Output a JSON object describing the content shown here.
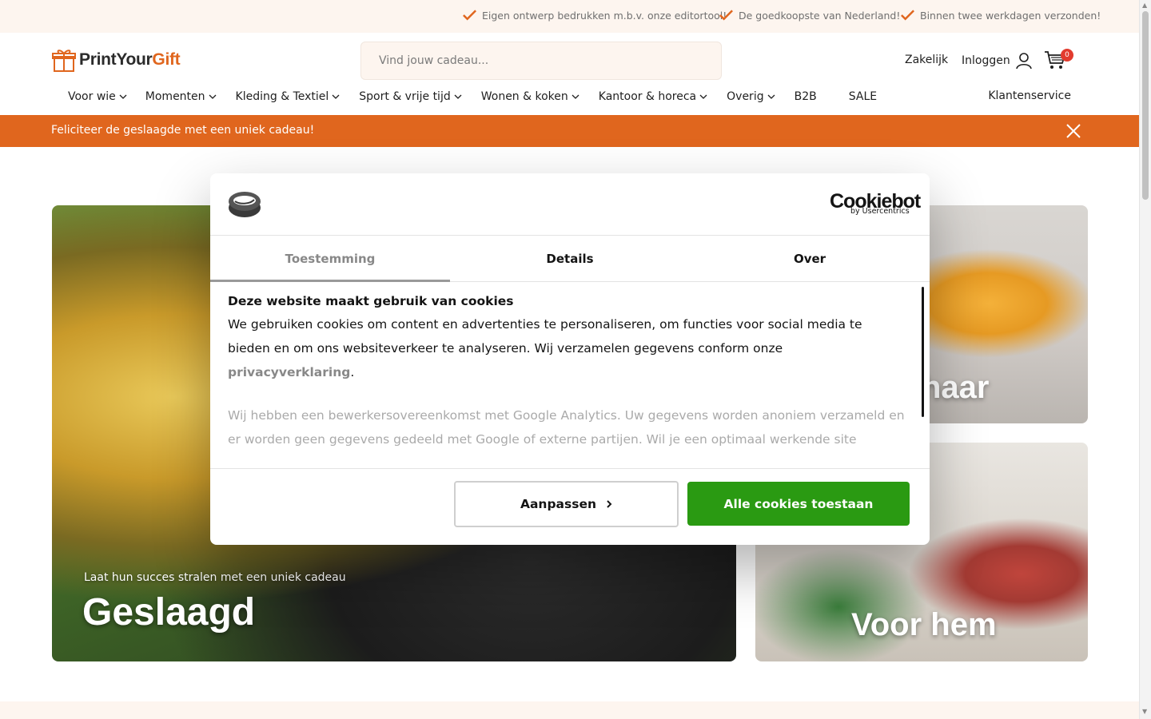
{
  "topbar": {
    "usps": [
      "Eigen ontwerp bedrukken m.b.v. onze editortool!",
      "De goedkoopste van Nederland!",
      "Binnen twee werkdagen verzonden!"
    ]
  },
  "header": {
    "logo_print": "PrintYour",
    "logo_gift": "Gift",
    "search_placeholder": "Vind jouw cadeau...",
    "zakelijk": "Zakelijk",
    "inloggen": "Inloggen",
    "cart_count": "0"
  },
  "nav": {
    "items": [
      "Voor wie",
      "Momenten",
      "Kleding & Textiel",
      "Sport & vrije tijd",
      "Wonen & koken",
      "Kantoor & horeca",
      "Overig",
      "B2B",
      "SALE"
    ],
    "klantenservice": "Klantenservice"
  },
  "promo": {
    "text": "Feliciteer de geslaagde met een uniek cadeau!"
  },
  "hero": {
    "sub": "Laat hun succes stralen met een uniek cadeau",
    "title": "Geslaagd"
  },
  "cards": {
    "haar": "haar",
    "hem": "Voor hem"
  },
  "cookie": {
    "brand": "Cookiebot",
    "brand_sub": "by Usercentrics",
    "tabs": [
      "Toestemming",
      "Details",
      "Over"
    ],
    "heading": "Deze website maakt gebruik van cookies",
    "p1_a": "We gebruiken cookies om content en advertenties te personaliseren, om functies voor social media te bieden en om ons websiteverkeer te analyseren. Wij verzamelen gegevens conform onze ",
    "p1_link": "privacyverklaring",
    "p1_end": ".",
    "p2": "Wij hebben een bewerkersovereenkomst met Google Analytics. Uw gegevens worden anoniem verzameld en er worden geen gegevens gedeeld met Google of externe partijen. Wil je een optimaal werkende site",
    "btn_customize": "Aanpassen",
    "btn_allow": "Alle cookies toestaan"
  },
  "colors": {
    "brand_orange": "#e0661e",
    "allow_green": "#2a9a12",
    "topbar_bg": "#fdf5ef"
  }
}
